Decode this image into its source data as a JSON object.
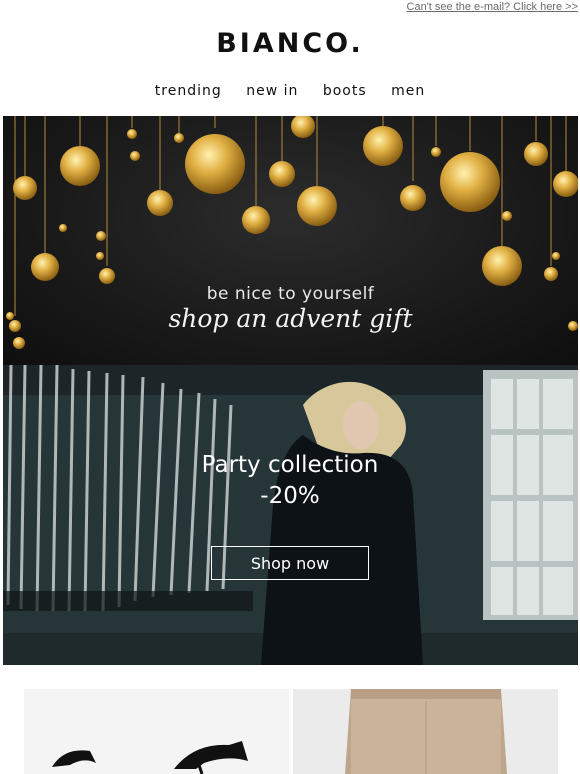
{
  "header": {
    "view_online": "Can't see the e-mail? Click here >>",
    "logo": "BIANCO."
  },
  "nav": {
    "items": [
      "trending",
      "new in",
      "boots",
      "men"
    ]
  },
  "banner_advent": {
    "line1": "be nice to yourself",
    "line2": "shop an advent gift"
  },
  "banner_party": {
    "title": "Party collection",
    "discount": "-20%",
    "button": "Shop now"
  },
  "colors": {
    "text": "#111111",
    "gold": "#d9a73a",
    "banner_dark": "#1b1b1b"
  }
}
